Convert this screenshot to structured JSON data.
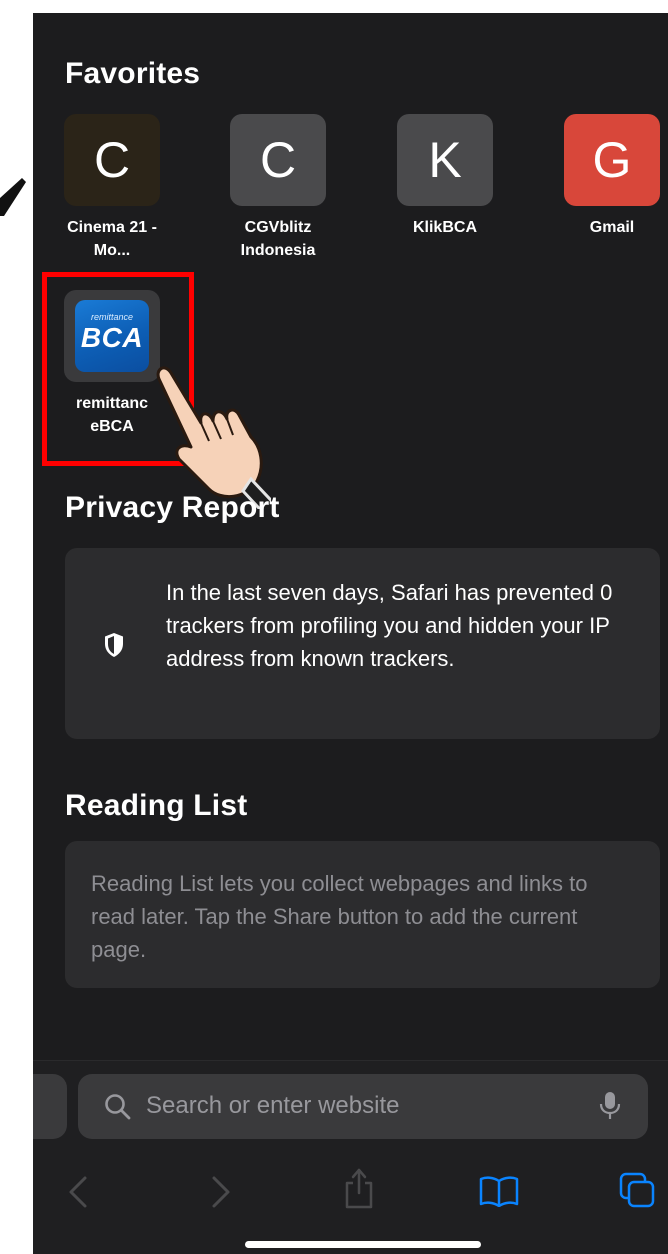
{
  "favorites": {
    "title": "Favorites",
    "items": [
      {
        "letter": "C",
        "label": "Cinema 21 - Mo...",
        "tile_color": "#2b2418"
      },
      {
        "letter": "C",
        "label": "CGVblitz Indonesia",
        "tile_color": "#4a4a4c"
      },
      {
        "letter": "K",
        "label": "KlikBCA",
        "tile_color": "#4a4a4c"
      },
      {
        "letter": "G",
        "label": "Gmail",
        "tile_color": "#d8473a"
      }
    ],
    "highlighted": {
      "logo_small": "remittance",
      "logo_big": "BCA",
      "label": "remittanc eBCA"
    }
  },
  "privacy_report": {
    "title": "Privacy Report",
    "text": "In the last seven days, Safari has prevented 0 trackers from profiling you and hidden your IP address from known trackers.",
    "icon": "shield-icon"
  },
  "reading_list": {
    "title": "Reading List",
    "text": "Reading List lets you collect webpages and links to read later. Tap the Share button to add the current page."
  },
  "toolbar": {
    "search_placeholder": "Search or enter website",
    "icons": [
      "search-icon",
      "microphone-icon",
      "back-icon",
      "forward-icon",
      "share-icon",
      "bookmarks-icon",
      "tabs-icon"
    ]
  },
  "colors": {
    "background": "#1c1c1e",
    "card": "#2c2c2e",
    "accent": "#0a84ff",
    "highlight": "#ff0000"
  }
}
